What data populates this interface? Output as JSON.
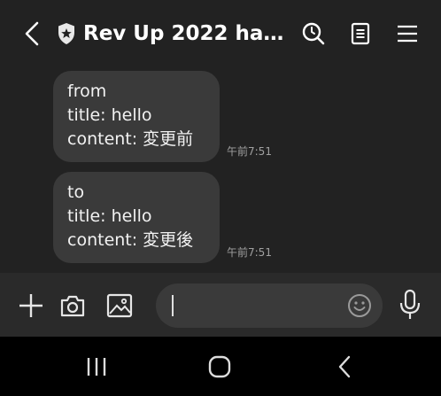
{
  "header": {
    "title": "Rev Up 2022 han...",
    "icons": {
      "back": "chevron-left-icon",
      "shield": "shield-star-icon",
      "search": "search-message-icon",
      "notes": "notes-icon",
      "menu": "hamburger-menu-icon"
    }
  },
  "messages": [
    {
      "lines": [
        "from",
        "title: hello",
        "content: 変更前"
      ],
      "time": "午前7:51"
    },
    {
      "lines": [
        "to",
        "title: hello",
        "content: 変更後"
      ],
      "time": "午前7:51"
    }
  ],
  "input": {
    "value": "",
    "icons": {
      "plus": "plus-icon",
      "camera": "camera-icon",
      "gallery": "image-icon",
      "emoji": "emoji-icon",
      "mic": "microphone-icon"
    }
  },
  "navbar": {
    "icons": {
      "recents": "recents-icon",
      "home": "home-icon",
      "back": "back-icon"
    }
  },
  "colors": {
    "background": "#222222",
    "bubble": "#3a3a3a",
    "input_bar": "#2a2a2a",
    "nav_bar": "#000000",
    "timestamp": "#a0a0a0"
  }
}
